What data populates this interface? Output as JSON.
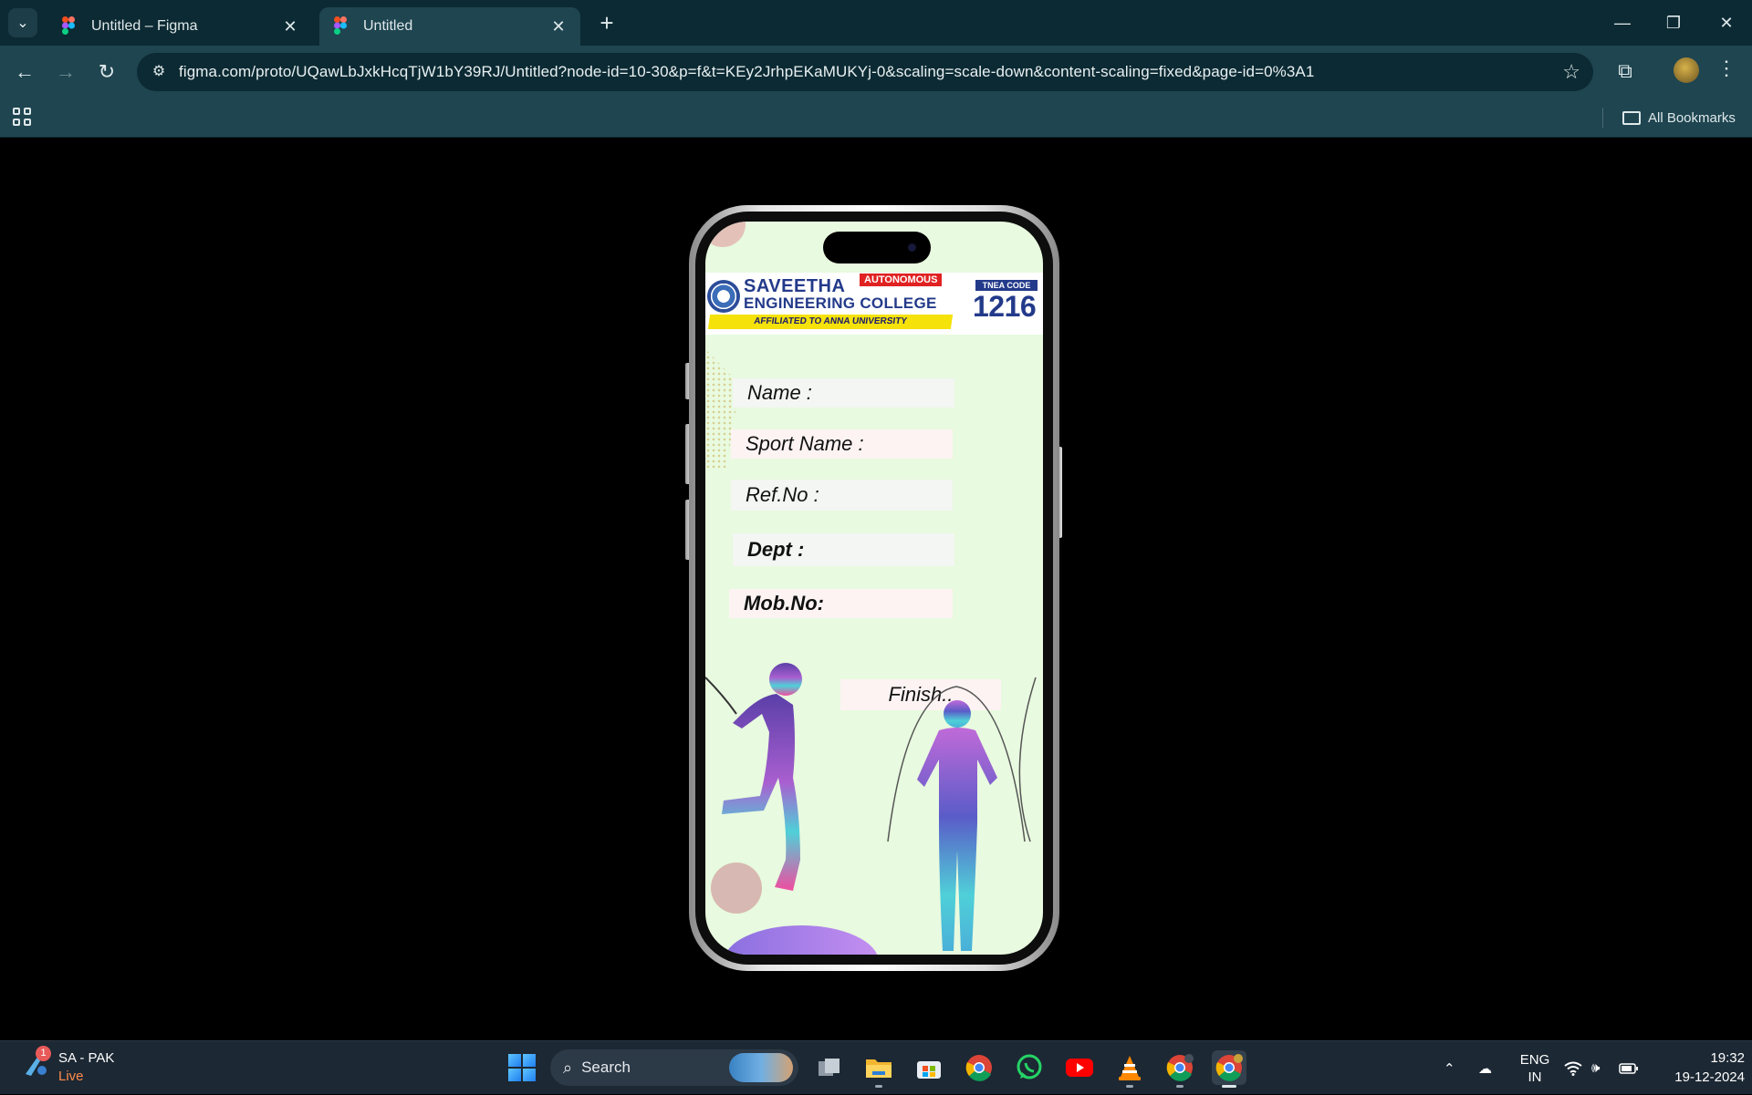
{
  "browser": {
    "tabs": [
      {
        "title": "Untitled – Figma",
        "active": false
      },
      {
        "title": "Untitled",
        "active": true
      }
    ],
    "url": "figma.com/proto/UQawLbJxkHcqTjW1bY39RJ/Untitled?node-id=10-30&p=f&t=KEy2JrhpEKaMUKYj-0&scaling=scale-down&content-scaling=fixed&page-id=0%3A1",
    "bookmarks_label": "All Bookmarks",
    "colors": {
      "chrome_dark": "#0c2a33",
      "chrome_light": "#1e4550"
    }
  },
  "prototype": {
    "header": {
      "college_line1": "SAVEETHA",
      "college_line2": "ENGINEERING COLLEGE",
      "autonomous": "AUTONOMOUS",
      "affiliated": "AFFILIATED TO ANNA UNIVERSITY",
      "tnea_label": "TNEA CODE",
      "tnea_code": "1216"
    },
    "fields": [
      {
        "label": "Name :"
      },
      {
        "label": "Sport Name :"
      },
      {
        "label": "Ref.No :"
      },
      {
        "label": "Dept :"
      },
      {
        "label": "Mob.No:"
      }
    ],
    "finish_label": "Finish..",
    "colors": {
      "screen_bg": "#e8fadf",
      "brand_blue": "#233a8a",
      "badge_red": "#e02222",
      "band_yellow": "#f5e20a"
    }
  },
  "taskbar": {
    "weather_badge": "1",
    "weather_title": "SA - PAK",
    "weather_status": "Live",
    "search_label": "Search",
    "apps": [
      "task-view",
      "file-explorer",
      "microsoft-store",
      "chrome",
      "whatsapp",
      "youtube",
      "vlc",
      "chrome-profile",
      "chrome-active"
    ],
    "language_line1": "ENG",
    "language_line2": "IN",
    "time": "19:32",
    "date": "19-12-2024"
  }
}
